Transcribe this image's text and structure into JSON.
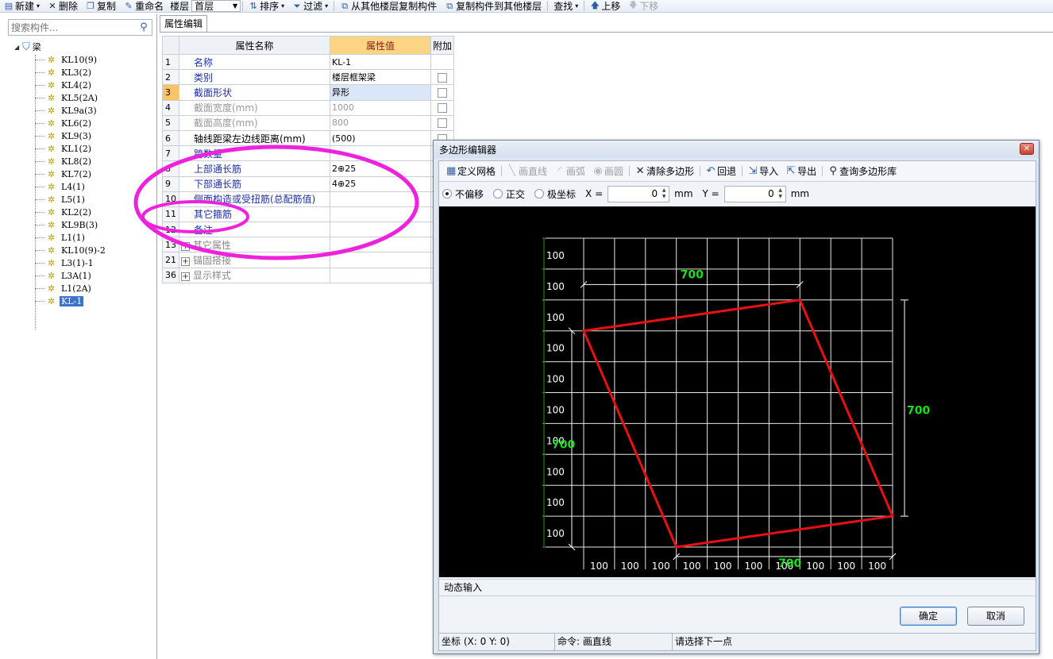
{
  "toolbar": {
    "new_label": "新建",
    "delete_label": "删除",
    "copy_label": "复制",
    "rename_label": "重命名",
    "floor_label": "楼层",
    "floor_value": "首层",
    "sort_label": "排序",
    "filter_label": "过滤",
    "copy_from_floor_label": "从其他楼层复制构件",
    "copy_to_floor_label": "复制构件到其他楼层",
    "find_label": "查找",
    "move_up_label": "上移",
    "move_down_label": "下移"
  },
  "search": {
    "placeholder": "搜索构件..."
  },
  "tree": {
    "root_label": "梁",
    "items": [
      "KL10(9)",
      "KL3(2)",
      "KL4(2)",
      "KL5(2A)",
      "KL9a(3)",
      "KL6(2)",
      "KL9(3)",
      "KL1(2)",
      "KL8(2)",
      "KL7(2)",
      "L4(1)",
      "L5(1)",
      "KL2(2)",
      "KL9B(3)",
      "L1(1)",
      "KL10(9)-2",
      "L3(1)-1",
      "L3A(1)",
      "L1(2A)",
      "KL-1"
    ],
    "selected": "KL-1"
  },
  "tab": {
    "label": "属性编辑"
  },
  "props": {
    "col_name": "属性名称",
    "col_value": "属性值",
    "col_add": "附加",
    "rows": [
      {
        "num": "1",
        "name": "名称",
        "value": "KL-1"
      },
      {
        "num": "2",
        "name": "类别",
        "value": "楼层框架梁"
      },
      {
        "num": "3",
        "name": "截面形状",
        "value": "异形"
      },
      {
        "num": "4",
        "name": "截面宽度(mm)",
        "value": "1000"
      },
      {
        "num": "5",
        "name": "截面高度(mm)",
        "value": "800"
      },
      {
        "num": "6",
        "name": "轴线距梁左边线距离(mm)",
        "value": "(500)"
      },
      {
        "num": "7",
        "name": "跨数量",
        "value": ""
      },
      {
        "num": "8",
        "name": "上部通长筋",
        "value": "2⊕25"
      },
      {
        "num": "9",
        "name": "下部通长筋",
        "value": "4⊕25"
      },
      {
        "num": "10",
        "name": "侧面构造或受扭筋(总配筋值)",
        "value": ""
      },
      {
        "num": "11",
        "name": "其它箍筋",
        "value": ""
      },
      {
        "num": "12",
        "name": "备注",
        "value": ""
      },
      {
        "num": "13",
        "name": "其它属性",
        "value": ""
      },
      {
        "num": "21",
        "name": "锚固搭接",
        "value": ""
      },
      {
        "num": "36",
        "name": "显示样式",
        "value": ""
      }
    ]
  },
  "dialog": {
    "title": "多边形编辑器",
    "tools": {
      "define_grid": "定义网格",
      "draw_line": "画直线",
      "draw_arc": "画弧",
      "draw_circle": "画圆",
      "clear_polygon": "清除多边形",
      "undo": "回退",
      "import": "导入",
      "export": "导出",
      "query_library": "查询多边形库"
    },
    "options": {
      "no_offset": "不偏移",
      "ortho": "正交",
      "polar": "极坐标",
      "x_label": "X =",
      "x_value": "0",
      "x_unit": "mm",
      "y_label": "Y =",
      "y_value": "0",
      "y_unit": "mm"
    },
    "grid": {
      "row_labels": [
        "100",
        "100",
        "100",
        "100",
        "100",
        "100",
        "100",
        "100",
        "100",
        "100"
      ],
      "col_labels": [
        "100",
        "100",
        "100",
        "100",
        "100",
        "100",
        "100",
        "100",
        "100",
        "100"
      ],
      "dim_top": "700",
      "dim_right": "700",
      "dim_left": "700",
      "dim_bottom": "700",
      "line_color": "#e6e6e6",
      "polygon_color": "#e81010",
      "dim_text_color": "#19e019",
      "grid_label_color": "#ffffff"
    },
    "dynamic_input_label": "动态输入",
    "ok_label": "确定",
    "cancel_label": "取消",
    "status": {
      "coord": "坐标 (X: 0 Y: 0)",
      "command": "命令: 画直线",
      "prompt": "请选择下一点"
    }
  },
  "annotation": {
    "color": "#ee22dd"
  }
}
